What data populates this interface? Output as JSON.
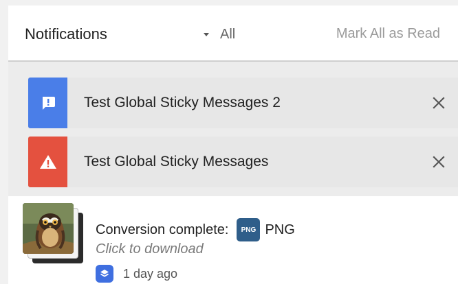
{
  "header": {
    "title": "Notifications",
    "filter_label": "All",
    "mark_all_label": "Mark All as Read"
  },
  "sticky_messages": [
    {
      "text": "Test Global Sticky Messages 2",
      "icon": "message-alert-icon",
      "color": "#4a7ee8"
    },
    {
      "text": "Test Global Sticky Messages",
      "icon": "warning-icon",
      "color": "#e4513f"
    }
  ],
  "notification": {
    "title_prefix": "Conversion complete:",
    "format_badge": "PNG",
    "format_label": "PNG",
    "link_text": "Click to download",
    "time": "1 day ago",
    "icon": "layers-icon"
  },
  "colors": {
    "accent_blue": "#4a7ee8",
    "alert_red": "#e4513f",
    "badge_navy": "#2f5e8a"
  }
}
